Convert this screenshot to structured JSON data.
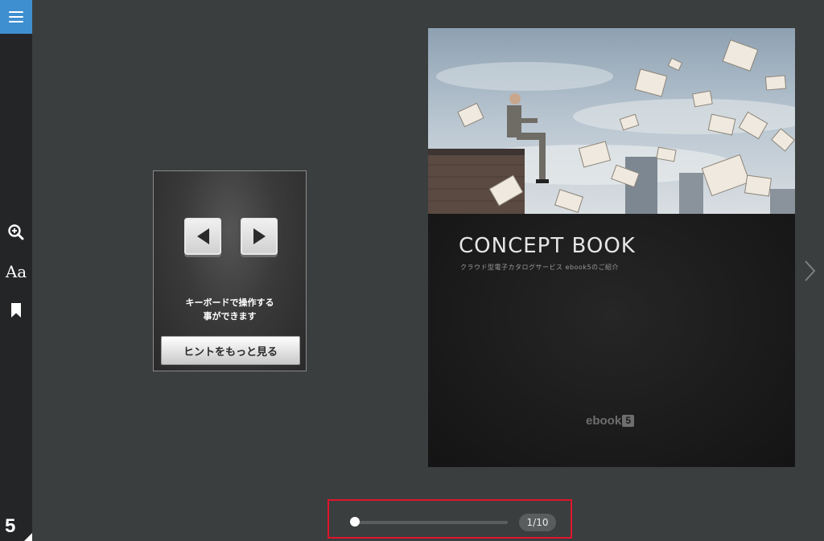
{
  "sidebar": {
    "menu_icon": "hamburger-menu-icon",
    "tools": [
      {
        "name": "zoom-in",
        "icon": "zoom-in-icon"
      },
      {
        "name": "font-size",
        "icon": "font-size-icon",
        "label": "Aa"
      },
      {
        "name": "bookmark",
        "icon": "bookmark-icon"
      }
    ],
    "brand_mark": "5"
  },
  "hint": {
    "keys": [
      "left-arrow-key-icon",
      "right-arrow-key-icon"
    ],
    "line1": "キーボードで操作する",
    "line2": "事ができます",
    "button_label": "ヒントをもっと見る"
  },
  "book": {
    "title": "CONCEPT BOOK",
    "subtitle": "クラウド型電子カタログサービス ebook5のご紹介",
    "logo_text": "ebook",
    "logo_badge": "5"
  },
  "pager": {
    "current_page": 1,
    "total_pages": 10,
    "counter_text": "1/10",
    "highlight_color": "#e0142c"
  },
  "colors": {
    "accent": "#3e8fd0",
    "background": "#3b3e3f",
    "sidebar": "#232526"
  }
}
